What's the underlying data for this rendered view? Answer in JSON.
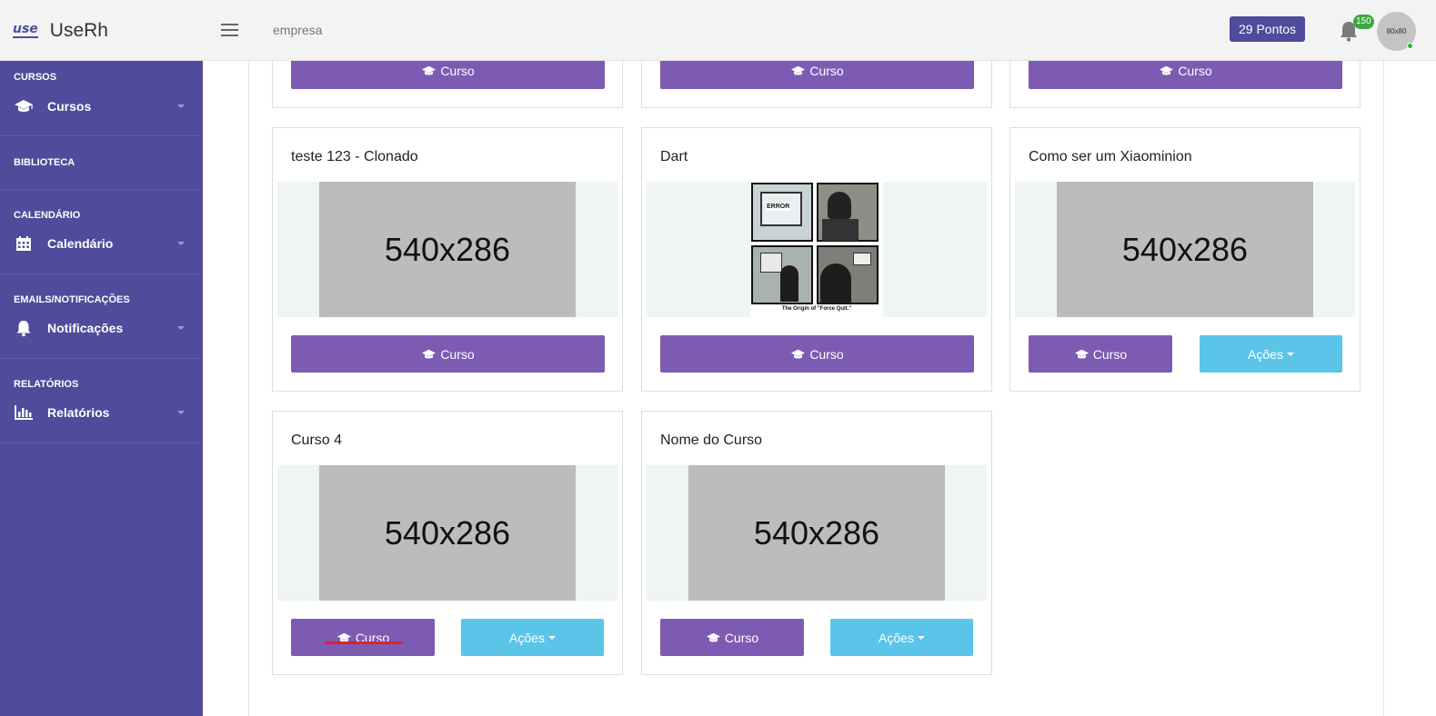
{
  "header": {
    "logo_mark": "use",
    "app_name": "UseRh",
    "company": "empresa",
    "points": "29 Pontos",
    "notification_count": "150",
    "avatar_text": "80x80"
  },
  "sidebar": {
    "sections": [
      {
        "title": "CURSOS",
        "item": "Cursos",
        "icon": "graduation-cap-icon"
      },
      {
        "title": "BIBLIOTECA"
      },
      {
        "title": "CALENDÁRIO",
        "item": "Calendário",
        "icon": "calendar-icon"
      },
      {
        "title": "EMAILS/NOTIFICAÇÕES",
        "item": "Notificações",
        "icon": "bell-icon"
      },
      {
        "title": "RELATÓRIOS",
        "item": "Relatórios",
        "icon": "bar-chart-icon"
      }
    ]
  },
  "cards": {
    "partial_button": "Curso",
    "items": [
      {
        "title": "teste 123 - Clonado",
        "image": "540x286",
        "button": "Curso"
      },
      {
        "title": "Dart",
        "image_caption": "The Origin of \"Force Quit.\"",
        "image_error": "ERROR",
        "button": "Curso"
      },
      {
        "title": "Como ser um Xiaominion",
        "image": "540x286",
        "button": "Curso",
        "actions": "Ações"
      },
      {
        "title": "Curso 4",
        "image": "540x286",
        "button": "Curso",
        "actions": "Ações"
      },
      {
        "title": "Nome do Curso",
        "image": "540x286",
        "button": "Curso",
        "actions": "Ações"
      }
    ]
  },
  "colors": {
    "sidebar": "#4e4c9b",
    "button_purple": "#7e5bb3",
    "button_blue": "#5bc5e9",
    "badge_green": "#3fa73f"
  }
}
